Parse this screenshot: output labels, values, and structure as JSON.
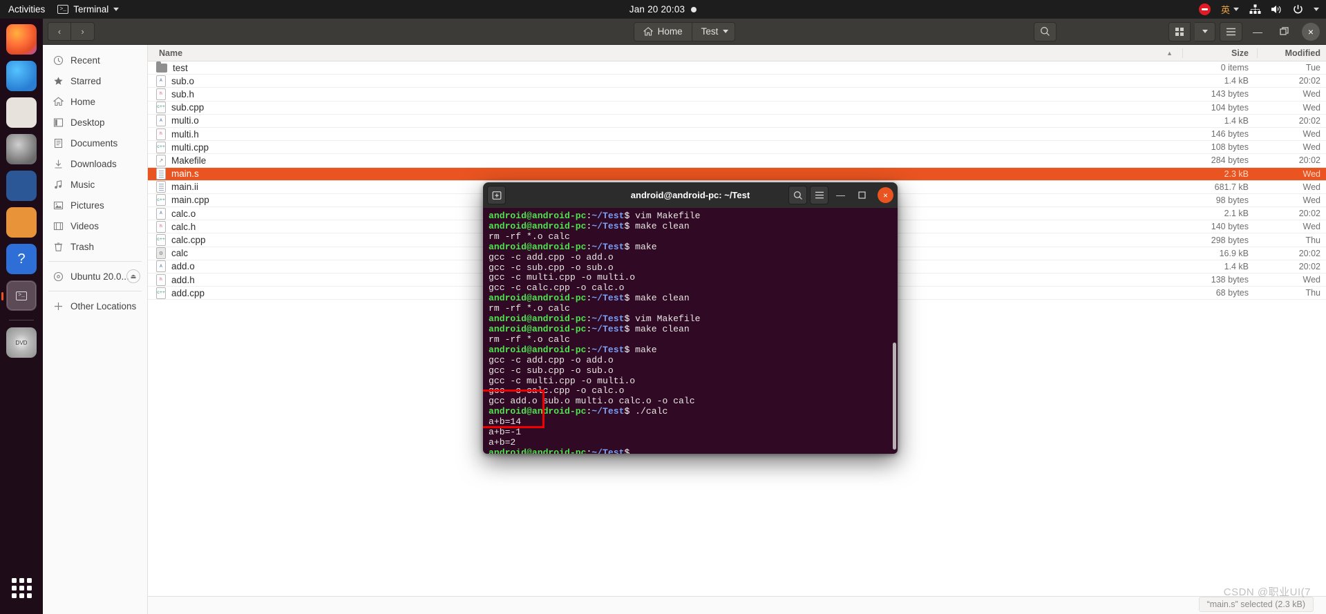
{
  "topbar": {
    "activities": "Activities",
    "app_name": "Terminal",
    "clock": "Jan 20  20:03",
    "ime": "英"
  },
  "dock": {
    "items": [
      {
        "name": "firefox",
        "label": ""
      },
      {
        "name": "thunderbird",
        "label": ""
      },
      {
        "name": "files",
        "label": ""
      },
      {
        "name": "rhythmbox",
        "label": ""
      },
      {
        "name": "libreoffice-writer",
        "label": ""
      },
      {
        "name": "ubuntu-software",
        "label": ""
      },
      {
        "name": "help",
        "label": ""
      },
      {
        "name": "terminal",
        "label": ""
      },
      {
        "name": "dvd-drive",
        "label": ""
      }
    ],
    "show_apps": "Show Applications"
  },
  "files": {
    "nav": {
      "back": "‹",
      "forward": "›"
    },
    "path": [
      {
        "label": "Home",
        "icon": "home-icon"
      },
      {
        "label": "Test",
        "icon": "chevron-down-icon"
      }
    ],
    "toolbar": {
      "search": "search-icon",
      "view_grid": "grid-view-icon",
      "view_dropdown": "chevron-down-icon",
      "menu": "hamburger-menu-icon",
      "minimize": "—",
      "maximize": "❐",
      "close": "×"
    },
    "sidebar": [
      {
        "label": "Recent",
        "icon": "clock-icon"
      },
      {
        "label": "Starred",
        "icon": "star-icon"
      },
      {
        "label": "Home",
        "icon": "home-icon"
      },
      {
        "label": "Desktop",
        "icon": "desktop-icon"
      },
      {
        "label": "Documents",
        "icon": "documents-icon"
      },
      {
        "label": "Downloads",
        "icon": "download-icon"
      },
      {
        "label": "Music",
        "icon": "music-icon"
      },
      {
        "label": "Pictures",
        "icon": "pictures-icon"
      },
      {
        "label": "Videos",
        "icon": "videos-icon"
      },
      {
        "label": "Trash",
        "icon": "trash-icon"
      }
    ],
    "sidebar_devices": [
      {
        "label": "Ubuntu 20.0...",
        "icon": "disc-icon",
        "eject": "⏏"
      },
      {
        "label": "Other Locations",
        "icon": "plus-icon"
      }
    ],
    "columns": [
      "Name",
      "Size",
      "Modified"
    ],
    "rows": [
      {
        "name": "test",
        "icon": "folder",
        "size": "0 items",
        "modified": "Tue",
        "selected": false
      },
      {
        "name": "sub.o",
        "icon": "asm",
        "size": "1.4 kB",
        "modified": "20:02",
        "selected": false
      },
      {
        "name": "sub.h",
        "icon": "hdr",
        "size": "143 bytes",
        "modified": "Wed",
        "selected": false
      },
      {
        "name": "sub.cpp",
        "icon": "cpp",
        "size": "104 bytes",
        "modified": "Wed",
        "selected": false
      },
      {
        "name": "multi.o",
        "icon": "asm",
        "size": "1.4 kB",
        "modified": "20:02",
        "selected": false
      },
      {
        "name": "multi.h",
        "icon": "hdr",
        "size": "146 bytes",
        "modified": "Wed",
        "selected": false
      },
      {
        "name": "multi.cpp",
        "icon": "cpp",
        "size": "108 bytes",
        "modified": "Wed",
        "selected": false
      },
      {
        "name": "Makefile",
        "icon": "mk",
        "size": "284 bytes",
        "modified": "20:02",
        "selected": false
      },
      {
        "name": "main.s",
        "icon": "doc",
        "size": "2.3 kB",
        "modified": "Wed",
        "selected": true
      },
      {
        "name": "main.ii",
        "icon": "doc",
        "size": "681.7 kB",
        "modified": "Wed",
        "selected": false
      },
      {
        "name": "main.cpp",
        "icon": "cpp",
        "size": "98 bytes",
        "modified": "Wed",
        "selected": false
      },
      {
        "name": "calc.o",
        "icon": "asm",
        "size": "2.1 kB",
        "modified": "20:02",
        "selected": false
      },
      {
        "name": "calc.h",
        "icon": "hdr",
        "size": "140 bytes",
        "modified": "Wed",
        "selected": false
      },
      {
        "name": "calc.cpp",
        "icon": "cpp",
        "size": "298 bytes",
        "modified": "Thu",
        "selected": false
      },
      {
        "name": "calc",
        "icon": "bin",
        "size": "16.9 kB",
        "modified": "20:02",
        "selected": false
      },
      {
        "name": "add.o",
        "icon": "asm",
        "size": "1.4 kB",
        "modified": "20:02",
        "selected": false
      },
      {
        "name": "add.h",
        "icon": "hdr",
        "size": "138 bytes",
        "modified": "Wed",
        "selected": false
      },
      {
        "name": "add.cpp",
        "icon": "cpp",
        "size": "68 bytes",
        "modified": "Thu",
        "selected": false
      }
    ],
    "status": "“main.s” selected (2.3 kB)",
    "watermark": "CSDN @职业UI(7"
  },
  "terminal": {
    "title": "android@android-pc: ~/Test",
    "new_tab": "new-tab-icon",
    "search": "search-icon",
    "menu": "hamburger-menu-icon",
    "minimize": "—",
    "maximize": "❐",
    "close": "×",
    "prompt": {
      "user": "android@android-pc",
      "colon": ":",
      "path": "~/Test",
      "dollar": "$"
    },
    "lines": [
      {
        "type": "prompt",
        "cmd": " vim Makefile"
      },
      {
        "type": "prompt",
        "cmd": " make clean"
      },
      {
        "type": "out",
        "text": "rm -rf *.o calc"
      },
      {
        "type": "prompt",
        "cmd": " make"
      },
      {
        "type": "out",
        "text": "gcc -c add.cpp -o add.o"
      },
      {
        "type": "out",
        "text": "gcc -c sub.cpp -o sub.o"
      },
      {
        "type": "out",
        "text": "gcc -c multi.cpp -o multi.o"
      },
      {
        "type": "out",
        "text": "gcc -c calc.cpp -o calc.o"
      },
      {
        "type": "prompt",
        "cmd": " make clean"
      },
      {
        "type": "out",
        "text": "rm -rf *.o calc"
      },
      {
        "type": "prompt",
        "cmd": " vim Makefile"
      },
      {
        "type": "prompt",
        "cmd": " make clean"
      },
      {
        "type": "out",
        "text": "rm -rf *.o calc"
      },
      {
        "type": "prompt",
        "cmd": " make"
      },
      {
        "type": "out",
        "text": "gcc -c add.cpp -o add.o"
      },
      {
        "type": "out",
        "text": "gcc -c sub.cpp -o sub.o"
      },
      {
        "type": "out",
        "text": "gcc -c multi.cpp -o multi.o"
      },
      {
        "type": "out",
        "text": "gcc -c calc.cpp -o calc.o"
      },
      {
        "type": "out",
        "text": "gcc add.o sub.o multi.o calc.o -o calc"
      },
      {
        "type": "prompt",
        "cmd": " ./calc"
      },
      {
        "type": "out",
        "text": "a+b=14"
      },
      {
        "type": "out",
        "text": "a+b=-1"
      },
      {
        "type": "out",
        "text": "a+b=2"
      },
      {
        "type": "prompt",
        "cmd": ""
      }
    ],
    "annotation": {
      "shape": "red-rectangle",
      "highlights": [
        "a+b=14",
        "a+b=-1",
        "a+b=2"
      ]
    }
  },
  "colors": {
    "accent": "#e95420",
    "terminal_bg": "#300a24",
    "prompt_user": "#4ee44e",
    "prompt_path": "#7a9ff5",
    "annotation": "#f00000",
    "topbar_bg": "#1d1d1d"
  }
}
